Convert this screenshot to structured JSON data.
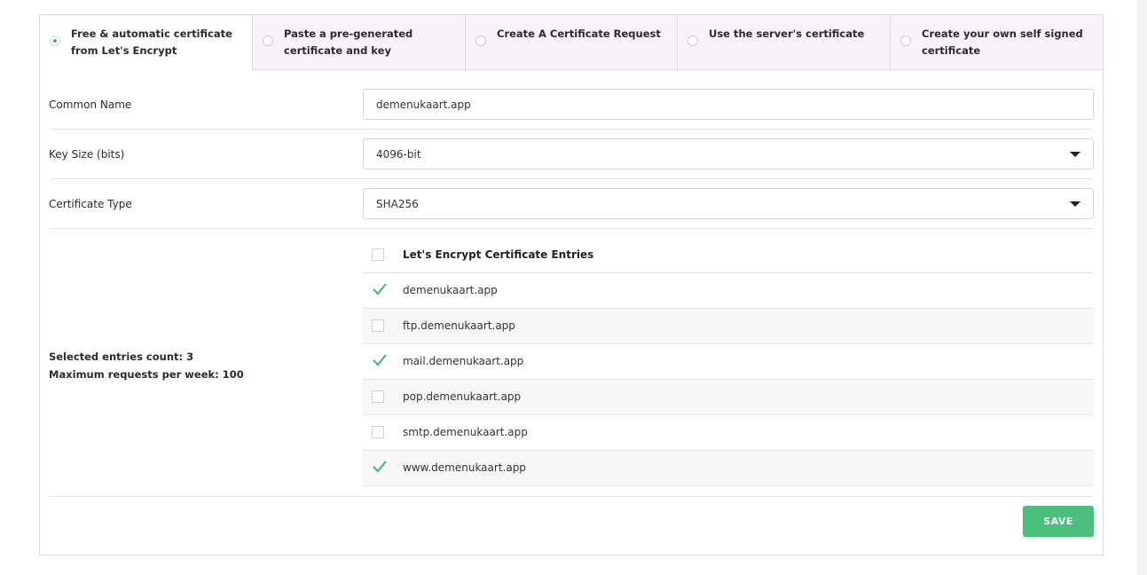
{
  "tabs": [
    {
      "label": "Free & automatic certificate from Let's Encrypt",
      "active": true
    },
    {
      "label": "Paste a pre-generated certificate and key",
      "active": false
    },
    {
      "label": "Create A Certificate Request",
      "active": false
    },
    {
      "label": "Use the server's certificate",
      "active": false
    },
    {
      "label": "Create your own self signed certificate",
      "active": false
    }
  ],
  "form": {
    "common_name": {
      "label": "Common Name",
      "value": "demenukaart.app"
    },
    "key_size": {
      "label": "Key Size (bits)",
      "value": "4096-bit"
    },
    "cert_type": {
      "label": "Certificate Type",
      "value": "SHA256"
    }
  },
  "entries": {
    "selected_count_label": "Selected entries count: 3",
    "max_requests_label": "Maximum requests per week: 100",
    "header": "Let's Encrypt Certificate Entries",
    "items": [
      {
        "label": "demenukaart.app",
        "checked": true
      },
      {
        "label": "ftp.demenukaart.app",
        "checked": false
      },
      {
        "label": "mail.demenukaart.app",
        "checked": true
      },
      {
        "label": "pop.demenukaart.app",
        "checked": false
      },
      {
        "label": "smtp.demenukaart.app",
        "checked": false
      },
      {
        "label": "www.demenukaart.app",
        "checked": true
      }
    ]
  },
  "actions": {
    "save_label": "SAVE"
  },
  "colors": {
    "accent": "#4bbf7d",
    "check": "#3db36d",
    "tab_bg": "#f7f3f9"
  }
}
